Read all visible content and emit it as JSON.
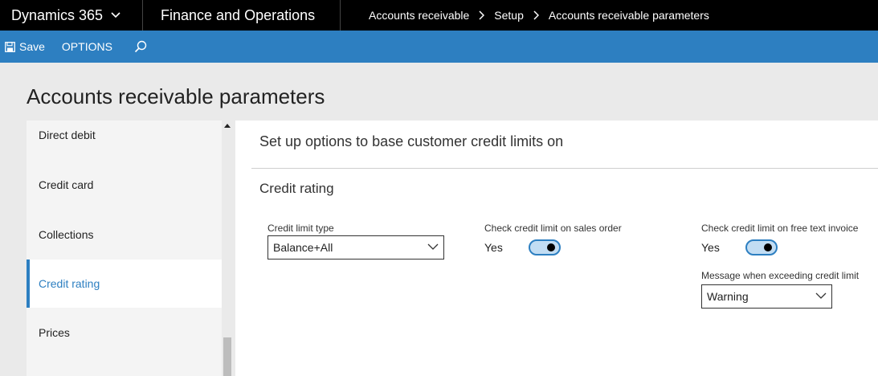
{
  "topbar": {
    "app_name": "Dynamics 365",
    "module_name": "Finance and Operations",
    "breadcrumb": [
      "Accounts receivable",
      "Setup",
      "Accounts receivable parameters"
    ]
  },
  "actionbar": {
    "save_label": "Save",
    "options_label": "OPTIONS"
  },
  "page": {
    "title": "Accounts receivable parameters"
  },
  "sidebar": {
    "items": [
      {
        "label": "Direct debit"
      },
      {
        "label": "Credit card"
      },
      {
        "label": "Collections"
      },
      {
        "label": "Credit rating",
        "active": true
      },
      {
        "label": "Prices"
      }
    ]
  },
  "main": {
    "section_header": "Set up options to base customer credit limits on",
    "group_title": "Credit rating",
    "credit_limit_type": {
      "label": "Credit limit type",
      "value": "Balance+All"
    },
    "check_sales_order": {
      "label": "Check credit limit on sales order",
      "value": "Yes"
    },
    "check_free_text": {
      "label": "Check credit limit on free text invoice",
      "value": "Yes"
    },
    "exceed_message": {
      "label": "Message when exceeding credit limit",
      "value": "Warning"
    }
  },
  "colors": {
    "accent": "#2d7fc1",
    "topbar": "#000000",
    "toggle_fill": "#c2ddf3"
  },
  "icons": {
    "save": "save-icon",
    "search": "search-icon",
    "chevron": "chevron-down-icon",
    "breadcrumb_separator": "chevron-right-icon"
  }
}
